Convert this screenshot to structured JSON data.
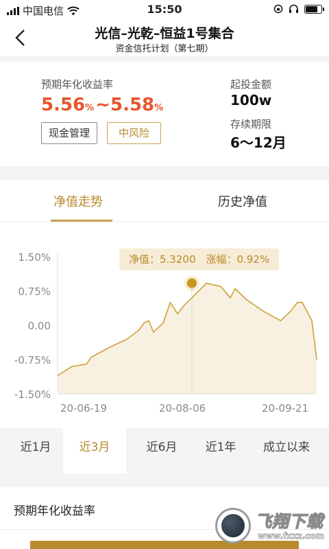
{
  "status_bar": {
    "carrier": "中国电信",
    "time": "15:50"
  },
  "nav": {
    "title": "光信–光乾–恒益1号集合",
    "subtitle": "资金信托计划（第七期）"
  },
  "product": {
    "rate_label": "预期年化收益率",
    "rate_low": "5.56",
    "rate_high": "5.58",
    "pct": "%",
    "range_sep": "~",
    "tag_cash": "现金管理",
    "tag_risk": "中风险",
    "min_invest_label": "起投金额",
    "min_invest_value": "100w",
    "term_label": "存续期限",
    "term_value": "6～12月"
  },
  "tabs": {
    "net_value_trend": "净值走势",
    "history_net_value": "历史净值"
  },
  "tooltip": {
    "text": "净值：5.3200　涨幅：0.92%"
  },
  "chart_data": {
    "type": "area",
    "y_ticks": [
      "1.50%",
      "0.75%",
      "0.00",
      "-0.75%",
      "-1.50%"
    ],
    "ylim": [
      -1.5,
      1.5
    ],
    "x_ticks": [
      "20-06-19",
      "20-08-06",
      "20-09-21"
    ],
    "xlim": [
      "2020-06-11",
      "2020-09-27"
    ],
    "x": [
      "2020-06-11",
      "2020-06-17",
      "2020-06-23",
      "2020-06-25",
      "2020-07-02",
      "2020-07-10",
      "2020-07-15",
      "2020-07-17",
      "2020-07-19",
      "2020-07-21",
      "2020-07-25",
      "2020-07-28",
      "2020-07-31",
      "2020-08-03",
      "2020-08-06",
      "2020-08-12",
      "2020-08-18",
      "2020-08-22",
      "2020-08-24",
      "2020-08-29",
      "2020-09-05",
      "2020-09-12",
      "2020-09-16",
      "2020-09-19",
      "2020-09-21",
      "2020-09-23",
      "2020-09-25",
      "2020-09-27"
    ],
    "y": [
      -1.1,
      -0.9,
      -0.85,
      -0.7,
      -0.5,
      -0.3,
      -0.1,
      0.05,
      0.1,
      -0.15,
      0.05,
      0.5,
      0.25,
      0.45,
      0.6,
      0.92,
      0.85,
      0.6,
      0.8,
      0.55,
      0.3,
      0.1,
      0.3,
      0.5,
      0.5,
      0.3,
      0.1,
      -0.75
    ],
    "highlight": {
      "x": "2020-08-06",
      "y": 0.92
    },
    "colors": {
      "line": "#d4a84a",
      "fill": "#f8f1e2",
      "marker": "#c8961e"
    },
    "grid": false
  },
  "ranges": [
    "近1月",
    "近3月",
    "近6月",
    "近1年",
    "成立以来"
  ],
  "active_range_index": 1,
  "section": {
    "title": "预期年化收益率"
  },
  "watermark": {
    "text": "飞翔下载",
    "url": "www.fxxz.com"
  },
  "colors": {
    "accent": "#b88a2e",
    "rate": "#e7552b"
  }
}
